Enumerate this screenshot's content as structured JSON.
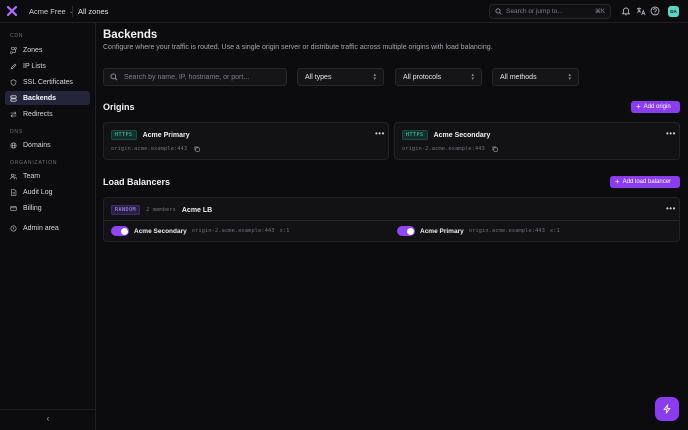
{
  "topbar": {
    "org_name": "Acme Free",
    "zones_label": "All zones",
    "search_placeholder": "Search or jump to...",
    "search_shortcut": "⌘K",
    "avatar_initials": "DA"
  },
  "sidebar": {
    "sections": [
      {
        "label": "CDN",
        "items": [
          "Zones",
          "IP Lists",
          "SSL Certificates",
          "Backends",
          "Redirects"
        ]
      },
      {
        "label": "DNS",
        "items": [
          "Domains"
        ]
      },
      {
        "label": "ORGANIZATION",
        "items": [
          "Team",
          "Audit Log",
          "Billing"
        ]
      }
    ],
    "admin_label": "Admin area",
    "active_item": "Backends"
  },
  "page": {
    "title": "Backends",
    "subtitle": "Configure where your traffic is routed. Use a single origin server or distribute traffic across multiple origins with load balancing."
  },
  "filters": {
    "search_placeholder": "Search by name, IP, hostname, or port...",
    "type_value": "All types",
    "protocol_value": "All protocols",
    "method_value": "All methods"
  },
  "origins": {
    "title": "Origins",
    "add_label": "Add origin",
    "items": [
      {
        "protocol": "HTTPS",
        "name": "Acme Primary",
        "address": "origin.acme.example:443"
      },
      {
        "protocol": "HTTPS",
        "name": "Acme Secondary",
        "address": "origin-2.acme.example:443"
      }
    ]
  },
  "load_balancers": {
    "title": "Load Balancers",
    "add_label": "Add load balancer",
    "items": [
      {
        "method": "RANDOM",
        "members_count": "2 members",
        "name": "Acme LB",
        "members": [
          {
            "name": "Acme Secondary",
            "address": "origin-2.acme.example:443",
            "weight": "x:1",
            "enabled": true
          },
          {
            "name": "Acme Primary",
            "address": "origin.acme.example:443",
            "weight": "x:1",
            "enabled": true
          }
        ]
      }
    ]
  },
  "colors": {
    "accent": "#8b3cf0",
    "background": "#0c0c0e",
    "card": "#121215",
    "https_badge": "#4fd1b8",
    "random_badge": "#b594ff"
  }
}
